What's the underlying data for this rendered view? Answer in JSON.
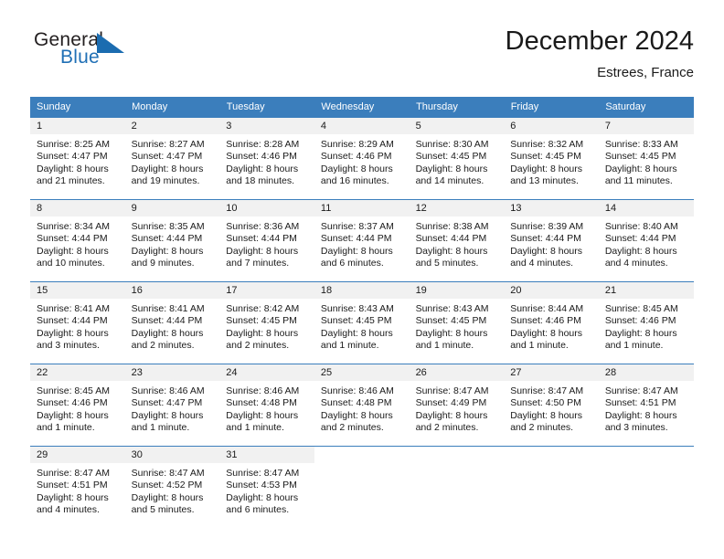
{
  "brand": {
    "name_part1": "General",
    "name_part2": "Blue",
    "flag_icon": "triangle-flag-icon"
  },
  "header": {
    "title": "December 2024",
    "location": "Estrees, France"
  },
  "calendar": {
    "weekday_headers": [
      "Sunday",
      "Monday",
      "Tuesday",
      "Wednesday",
      "Thursday",
      "Friday",
      "Saturday"
    ],
    "accent_color": "#3b7ebc",
    "daynum_band_color": "#f1f1f1",
    "weeks": [
      [
        {
          "day": "",
          "sunrise": "",
          "sunset": "",
          "daylight1": "",
          "daylight2": ""
        },
        {
          "day": "",
          "sunrise": "",
          "sunset": "",
          "daylight1": "",
          "daylight2": ""
        },
        {
          "day": "",
          "sunrise": "",
          "sunset": "",
          "daylight1": "",
          "daylight2": ""
        },
        {
          "day": "",
          "sunrise": "",
          "sunset": "",
          "daylight1": "",
          "daylight2": ""
        },
        {
          "day": "",
          "sunrise": "",
          "sunset": "",
          "daylight1": "",
          "daylight2": ""
        },
        {
          "day": "",
          "sunrise": "",
          "sunset": "",
          "daylight1": "",
          "daylight2": ""
        },
        {
          "day": "",
          "sunrise": "",
          "sunset": "",
          "daylight1": "",
          "daylight2": ""
        }
      ],
      [
        {
          "day": "1",
          "sunrise": "Sunrise: 8:25 AM",
          "sunset": "Sunset: 4:47 PM",
          "daylight1": "Daylight: 8 hours",
          "daylight2": "and 21 minutes."
        },
        {
          "day": "2",
          "sunrise": "Sunrise: 8:27 AM",
          "sunset": "Sunset: 4:47 PM",
          "daylight1": "Daylight: 8 hours",
          "daylight2": "and 19 minutes."
        },
        {
          "day": "3",
          "sunrise": "Sunrise: 8:28 AM",
          "sunset": "Sunset: 4:46 PM",
          "daylight1": "Daylight: 8 hours",
          "daylight2": "and 18 minutes."
        },
        {
          "day": "4",
          "sunrise": "Sunrise: 8:29 AM",
          "sunset": "Sunset: 4:46 PM",
          "daylight1": "Daylight: 8 hours",
          "daylight2": "and 16 minutes."
        },
        {
          "day": "5",
          "sunrise": "Sunrise: 8:30 AM",
          "sunset": "Sunset: 4:45 PM",
          "daylight1": "Daylight: 8 hours",
          "daylight2": "and 14 minutes."
        },
        {
          "day": "6",
          "sunrise": "Sunrise: 8:32 AM",
          "sunset": "Sunset: 4:45 PM",
          "daylight1": "Daylight: 8 hours",
          "daylight2": "and 13 minutes."
        },
        {
          "day": "7",
          "sunrise": "Sunrise: 8:33 AM",
          "sunset": "Sunset: 4:45 PM",
          "daylight1": "Daylight: 8 hours",
          "daylight2": "and 11 minutes."
        }
      ],
      [
        {
          "day": "8",
          "sunrise": "Sunrise: 8:34 AM",
          "sunset": "Sunset: 4:44 PM",
          "daylight1": "Daylight: 8 hours",
          "daylight2": "and 10 minutes."
        },
        {
          "day": "9",
          "sunrise": "Sunrise: 8:35 AM",
          "sunset": "Sunset: 4:44 PM",
          "daylight1": "Daylight: 8 hours",
          "daylight2": "and 9 minutes."
        },
        {
          "day": "10",
          "sunrise": "Sunrise: 8:36 AM",
          "sunset": "Sunset: 4:44 PM",
          "daylight1": "Daylight: 8 hours",
          "daylight2": "and 7 minutes."
        },
        {
          "day": "11",
          "sunrise": "Sunrise: 8:37 AM",
          "sunset": "Sunset: 4:44 PM",
          "daylight1": "Daylight: 8 hours",
          "daylight2": "and 6 minutes."
        },
        {
          "day": "12",
          "sunrise": "Sunrise: 8:38 AM",
          "sunset": "Sunset: 4:44 PM",
          "daylight1": "Daylight: 8 hours",
          "daylight2": "and 5 minutes."
        },
        {
          "day": "13",
          "sunrise": "Sunrise: 8:39 AM",
          "sunset": "Sunset: 4:44 PM",
          "daylight1": "Daylight: 8 hours",
          "daylight2": "and 4 minutes."
        },
        {
          "day": "14",
          "sunrise": "Sunrise: 8:40 AM",
          "sunset": "Sunset: 4:44 PM",
          "daylight1": "Daylight: 8 hours",
          "daylight2": "and 4 minutes."
        }
      ],
      [
        {
          "day": "15",
          "sunrise": "Sunrise: 8:41 AM",
          "sunset": "Sunset: 4:44 PM",
          "daylight1": "Daylight: 8 hours",
          "daylight2": "and 3 minutes."
        },
        {
          "day": "16",
          "sunrise": "Sunrise: 8:41 AM",
          "sunset": "Sunset: 4:44 PM",
          "daylight1": "Daylight: 8 hours",
          "daylight2": "and 2 minutes."
        },
        {
          "day": "17",
          "sunrise": "Sunrise: 8:42 AM",
          "sunset": "Sunset: 4:45 PM",
          "daylight1": "Daylight: 8 hours",
          "daylight2": "and 2 minutes."
        },
        {
          "day": "18",
          "sunrise": "Sunrise: 8:43 AM",
          "sunset": "Sunset: 4:45 PM",
          "daylight1": "Daylight: 8 hours",
          "daylight2": "and 1 minute."
        },
        {
          "day": "19",
          "sunrise": "Sunrise: 8:43 AM",
          "sunset": "Sunset: 4:45 PM",
          "daylight1": "Daylight: 8 hours",
          "daylight2": "and 1 minute."
        },
        {
          "day": "20",
          "sunrise": "Sunrise: 8:44 AM",
          "sunset": "Sunset: 4:46 PM",
          "daylight1": "Daylight: 8 hours",
          "daylight2": "and 1 minute."
        },
        {
          "day": "21",
          "sunrise": "Sunrise: 8:45 AM",
          "sunset": "Sunset: 4:46 PM",
          "daylight1": "Daylight: 8 hours",
          "daylight2": "and 1 minute."
        }
      ],
      [
        {
          "day": "22",
          "sunrise": "Sunrise: 8:45 AM",
          "sunset": "Sunset: 4:46 PM",
          "daylight1": "Daylight: 8 hours",
          "daylight2": "and 1 minute."
        },
        {
          "day": "23",
          "sunrise": "Sunrise: 8:46 AM",
          "sunset": "Sunset: 4:47 PM",
          "daylight1": "Daylight: 8 hours",
          "daylight2": "and 1 minute."
        },
        {
          "day": "24",
          "sunrise": "Sunrise: 8:46 AM",
          "sunset": "Sunset: 4:48 PM",
          "daylight1": "Daylight: 8 hours",
          "daylight2": "and 1 minute."
        },
        {
          "day": "25",
          "sunrise": "Sunrise: 8:46 AM",
          "sunset": "Sunset: 4:48 PM",
          "daylight1": "Daylight: 8 hours",
          "daylight2": "and 2 minutes."
        },
        {
          "day": "26",
          "sunrise": "Sunrise: 8:47 AM",
          "sunset": "Sunset: 4:49 PM",
          "daylight1": "Daylight: 8 hours",
          "daylight2": "and 2 minutes."
        },
        {
          "day": "27",
          "sunrise": "Sunrise: 8:47 AM",
          "sunset": "Sunset: 4:50 PM",
          "daylight1": "Daylight: 8 hours",
          "daylight2": "and 2 minutes."
        },
        {
          "day": "28",
          "sunrise": "Sunrise: 8:47 AM",
          "sunset": "Sunset: 4:51 PM",
          "daylight1": "Daylight: 8 hours",
          "daylight2": "and 3 minutes."
        }
      ],
      [
        {
          "day": "29",
          "sunrise": "Sunrise: 8:47 AM",
          "sunset": "Sunset: 4:51 PM",
          "daylight1": "Daylight: 8 hours",
          "daylight2": "and 4 minutes."
        },
        {
          "day": "30",
          "sunrise": "Sunrise: 8:47 AM",
          "sunset": "Sunset: 4:52 PM",
          "daylight1": "Daylight: 8 hours",
          "daylight2": "and 5 minutes."
        },
        {
          "day": "31",
          "sunrise": "Sunrise: 8:47 AM",
          "sunset": "Sunset: 4:53 PM",
          "daylight1": "Daylight: 8 hours",
          "daylight2": "and 6 minutes."
        },
        {
          "day": "",
          "sunrise": "",
          "sunset": "",
          "daylight1": "",
          "daylight2": ""
        },
        {
          "day": "",
          "sunrise": "",
          "sunset": "",
          "daylight1": "",
          "daylight2": ""
        },
        {
          "day": "",
          "sunrise": "",
          "sunset": "",
          "daylight1": "",
          "daylight2": ""
        },
        {
          "day": "",
          "sunrise": "",
          "sunset": "",
          "daylight1": "",
          "daylight2": ""
        }
      ]
    ]
  }
}
